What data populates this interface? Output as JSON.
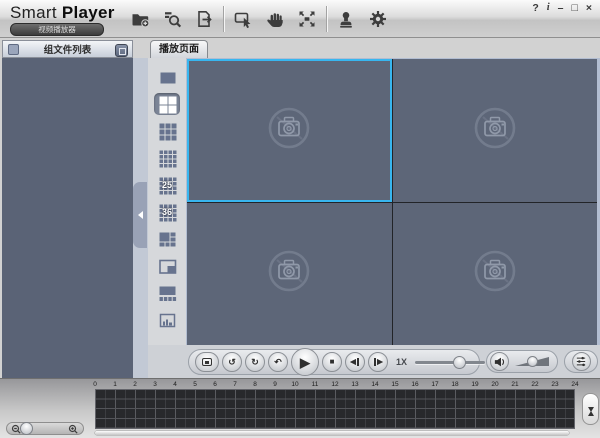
{
  "app": {
    "title_part1": "Smart ",
    "title_part2": "Player",
    "subtitle_badge": "视频播放器"
  },
  "titlebar": {
    "tools": [
      {
        "name": "open-folder",
        "icon": "folder-add-icon"
      },
      {
        "name": "search-files",
        "icon": "file-search-icon"
      },
      {
        "name": "export-file",
        "icon": "file-export-icon"
      },
      {
        "name": "select-tool",
        "icon": "cursor-select-icon"
      },
      {
        "name": "pan-tool",
        "icon": "hand-icon"
      },
      {
        "name": "fullscreen",
        "icon": "fullscreen-arrows-icon"
      },
      {
        "name": "watermark-verify",
        "icon": "stamp-icon"
      },
      {
        "name": "settings",
        "icon": "gear-icon"
      }
    ],
    "window_controls": [
      {
        "name": "help",
        "glyph": "?"
      },
      {
        "name": "info",
        "glyph": "i"
      },
      {
        "name": "minimize",
        "glyph": "–"
      },
      {
        "name": "maximize",
        "glyph": "□"
      },
      {
        "name": "close",
        "glyph": "×"
      }
    ]
  },
  "sidebar": {
    "title": "组文件列表",
    "icons": [
      "checkbox",
      "collapse-list-icon",
      "collapse-panel-arrow-icon"
    ]
  },
  "tab": {
    "label": "播放页面"
  },
  "layout_toolbar": [
    {
      "name": "split-1",
      "kind": "single",
      "selected": false
    },
    {
      "name": "split-4",
      "kind": "grid2",
      "selected": true
    },
    {
      "name": "split-9",
      "kind": "grid3",
      "selected": false
    },
    {
      "name": "split-16",
      "kind": "grid4",
      "selected": false
    },
    {
      "name": "split-25",
      "kind": "label",
      "label": "25",
      "selected": false
    },
    {
      "name": "split-36",
      "kind": "label",
      "label": "36",
      "selected": false
    },
    {
      "name": "split-big-left",
      "kind": "bigleft",
      "selected": false
    },
    {
      "name": "split-big-corner",
      "kind": "bigcorner",
      "selected": false
    },
    {
      "name": "split-big-top",
      "kind": "bigtop",
      "selected": false
    },
    {
      "name": "split-custom",
      "kind": "custom",
      "selected": false
    }
  ],
  "player": {
    "pane_count": 4,
    "selected_pane": 0,
    "placeholder_icon": "no-video-camera-icon",
    "speed_label": "1X",
    "glyphs": {
      "loop": "↺",
      "sync": "↻",
      "replay": "↶",
      "play": "▶",
      "stop": "■",
      "prev": "◀",
      "next": "▶"
    },
    "control_icons": [
      "fullscreen-video-icon",
      "loop-play-icon",
      "sync-play-icon",
      "replay-icon",
      "play-icon",
      "stop-icon",
      "prev-frame-icon",
      "next-frame-icon",
      "speaker-icon",
      "equalizer-icon"
    ]
  },
  "timeline": {
    "hour_labels": [
      "0",
      "1",
      "2",
      "3",
      "4",
      "5",
      "6",
      "7",
      "8",
      "9",
      "10",
      "11",
      "12",
      "13",
      "14",
      "15",
      "16",
      "17",
      "18",
      "19",
      "20",
      "21",
      "22",
      "23",
      "24"
    ],
    "row_count": 4,
    "icons": [
      "magnifier-minus-icon",
      "magnifier-plus-icon",
      "scroll-up-icon",
      "scroll-down-icon"
    ]
  },
  "colors": {
    "accent": "#38b6ef",
    "pane_bg": "#5d6678",
    "sidebar_bg": "#5a6376",
    "strip_bg": "#b2bdd1",
    "layout_selected": "#7b8496",
    "grid_bg": "#28292c"
  }
}
